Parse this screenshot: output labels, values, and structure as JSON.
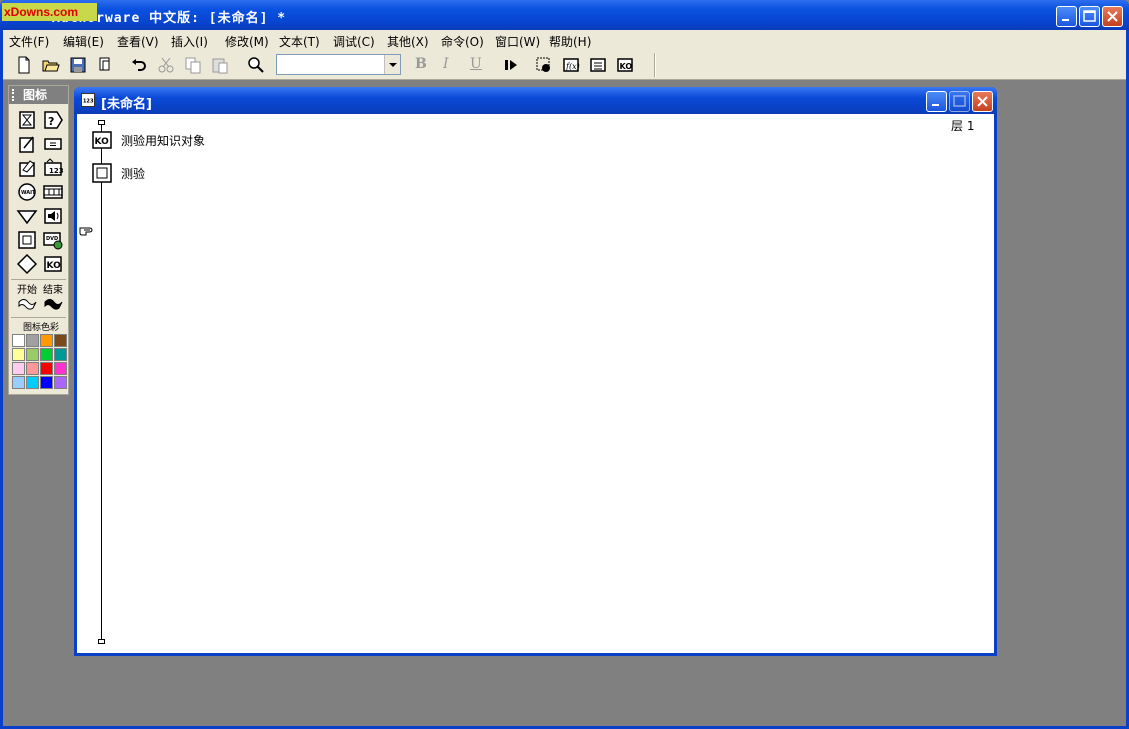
{
  "app": {
    "title": "Authorware 中文版: [未命名] *",
    "watermark": "xDowns.com"
  },
  "menu": {
    "items": [
      {
        "label": "文件(F)"
      },
      {
        "label": "编辑(E)"
      },
      {
        "label": "查看(V)"
      },
      {
        "label": "插入(I)"
      },
      {
        "label": "修改(M)"
      },
      {
        "label": "文本(T)"
      },
      {
        "label": "调试(C)"
      },
      {
        "label": "其他(X)"
      },
      {
        "label": "命令(O)"
      },
      {
        "label": "窗口(W)"
      },
      {
        "label": "帮助(H)"
      }
    ]
  },
  "toolbar": {
    "style_combo_value": "",
    "bold_label": "B",
    "italic_label": "I",
    "underline_label": "U"
  },
  "palette": {
    "title": "图标",
    "start_label": "开始",
    "end_label": "结束",
    "color_label": "图标色彩",
    "colors": [
      "#ffffff",
      "#a0a0a0",
      "#ff9900",
      "#7a4a1a",
      "#ffff99",
      "#99cc66",
      "#00cc33",
      "#009999",
      "#ffccee",
      "#ff9999",
      "#ff0000",
      "#ff33cc",
      "#99ccff",
      "#00ccff",
      "#0000ff",
      "#aa66ff"
    ]
  },
  "document": {
    "title": "[未命名]",
    "layer_label": "层 1",
    "flow_items": [
      {
        "label": "测验用知识对象",
        "icon": "knowledge-object-icon"
      },
      {
        "label": "测验",
        "icon": "framework-icon"
      }
    ]
  }
}
